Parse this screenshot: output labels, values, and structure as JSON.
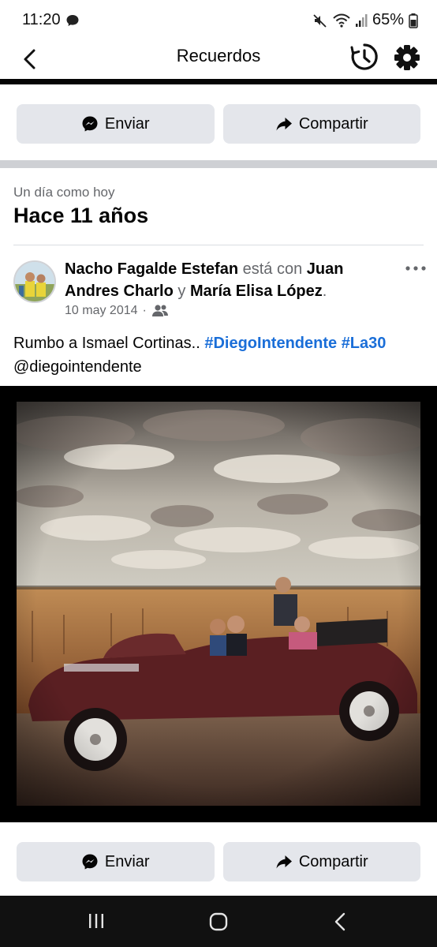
{
  "status_bar": {
    "time": "11:20",
    "battery": "65%"
  },
  "header": {
    "title": "Recuerdos"
  },
  "actions": {
    "send_label": "Enviar",
    "share_label": "Compartir"
  },
  "memory": {
    "subtitle": "Un día como hoy",
    "title": "Hace 11 años"
  },
  "post": {
    "author": "Nacho Fagalde Estefan",
    "with_text": "está con",
    "tagged_1": "Juan Andres Charlo",
    "and_text": "y",
    "tagged_2": "María Elisa López",
    "period": ".",
    "date": "10 may 2014",
    "date_separator": "·",
    "text": "Rumbo a Ismael Cortinas..",
    "hashtag_1": "#DiegoIntendente",
    "hashtag_2": "#La30",
    "mention": "@diegointendente"
  },
  "icons": {
    "back": "back-arrow-icon",
    "history": "history-icon",
    "settings": "gear-icon",
    "messenger": "messenger-icon",
    "share": "share-arrow-icon",
    "audience": "friends-icon",
    "more": "more-dots-icon"
  },
  "colors": {
    "hashtag": "#1a6ed8",
    "button_bg": "#e4e6eb",
    "muted": "#65676b"
  }
}
